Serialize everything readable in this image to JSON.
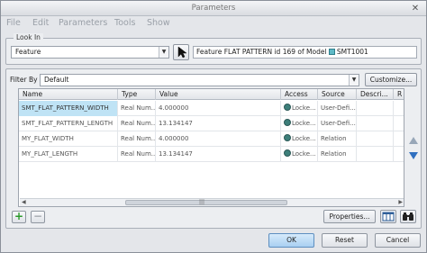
{
  "window": {
    "title": "Parameters",
    "close_glyph": "✕"
  },
  "menu": [
    "File",
    "Edit",
    "Parameters",
    "Tools",
    "Show"
  ],
  "look_in": {
    "group_label": "Look In",
    "combo_value": "Feature",
    "pick_icon": "cursor-arrow-icon",
    "feature_text": "Feature FLAT PATTERN id 169 of Model",
    "model_name": "SMT1001"
  },
  "filter": {
    "label": "Filter By",
    "value": "Default",
    "customize_label": "Customize..."
  },
  "table": {
    "headers": [
      "Name",
      "Type",
      "Value",
      "Access",
      "Source",
      "Descri...",
      "R"
    ],
    "rows": [
      {
        "name": "SMT_FLAT_PATTERN_WIDTH",
        "type": "Real Num...",
        "value": "4.000000",
        "access": "Locke...",
        "source": "User-Defi..."
      },
      {
        "name": "SMT_FLAT_PATTERN_LENGTH",
        "type": "Real Num...",
        "value": "13.134147",
        "access": "Locke...",
        "source": "User-Defi..."
      },
      {
        "name": "MY_FLAT_WIDTH",
        "type": "Real Num...",
        "value": "4.000000",
        "access": "Locke...",
        "source": "Relation"
      },
      {
        "name": "MY_FLAT_LENGTH",
        "type": "Real Num...",
        "value": "13.134147",
        "access": "Locke...",
        "source": "Relation"
      }
    ],
    "scroll_grip": "|||"
  },
  "actions": {
    "add_glyph": "+",
    "remove_glyph": "−",
    "properties_label": "Properties...",
    "columns_icon": "table-columns-icon",
    "binoculars_icon": "binoculars-icon"
  },
  "dialog": {
    "ok": "OK",
    "reset": "Reset",
    "cancel": "Cancel"
  },
  "colors": {
    "accent": "#2f6fc0",
    "selected_row": "#bfe3f5",
    "add_green": "#2a9a2a"
  }
}
